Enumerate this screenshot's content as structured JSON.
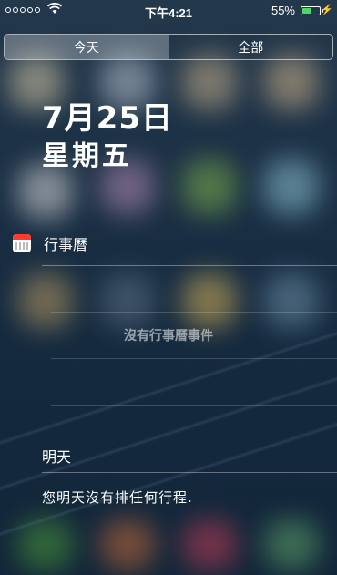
{
  "status_bar": {
    "signal": "●●●●●",
    "wifi_icon": "wifi-icon",
    "time": "下午4:21",
    "battery_percent": "55%",
    "battery_level": 0.55,
    "charging_icon": "⚡"
  },
  "tabs": {
    "today": "今天",
    "all": "全部",
    "selected": "today"
  },
  "date": {
    "month_day": "7月25日",
    "weekday": "星期五"
  },
  "calendar": {
    "icon": "calendar-icon",
    "title": "行事曆",
    "empty_message": "沒有行事曆事件"
  },
  "tomorrow": {
    "title": "明天",
    "message": "您明天沒有排任何行程."
  },
  "colors": {
    "battery": "#4cd964",
    "calendar_red": "#ff3b30"
  }
}
